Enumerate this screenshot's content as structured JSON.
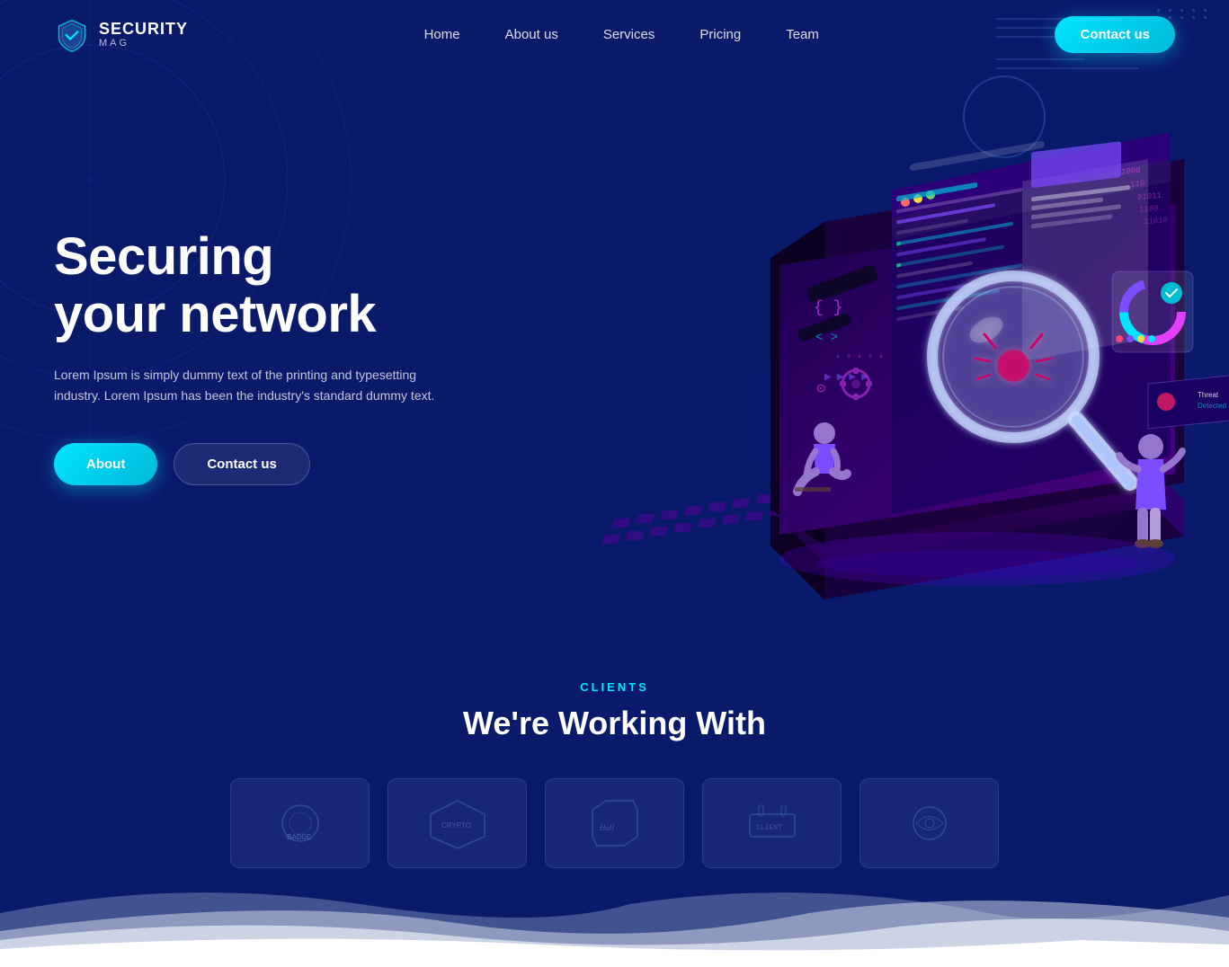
{
  "brand": {
    "name": "SECURITY",
    "sub": "MAG"
  },
  "nav": {
    "links": [
      {
        "label": "Home",
        "href": "#"
      },
      {
        "label": "About us",
        "href": "#"
      },
      {
        "label": "Services",
        "href": "#"
      },
      {
        "label": "Pricing",
        "href": "#"
      },
      {
        "label": "Team",
        "href": "#"
      }
    ],
    "cta": "Contact us"
  },
  "hero": {
    "title_line1": "Securing",
    "title_line2": "your network",
    "description": "Lorem Ipsum is simply dummy text of the printing and typesetting industry. Lorem Ipsum has been the industry's standard dummy text.",
    "btn_about": "About",
    "btn_contact": "Contact us"
  },
  "clients": {
    "label": "CLIENTS",
    "title": "We're Working With",
    "logos": [
      {
        "name": "client-1"
      },
      {
        "name": "client-2"
      },
      {
        "name": "client-3"
      },
      {
        "name": "client-4"
      },
      {
        "name": "client-5"
      }
    ]
  },
  "colors": {
    "accent": "#00e5ff",
    "bg": "#0a1a6b",
    "bg_dark": "#081158"
  }
}
